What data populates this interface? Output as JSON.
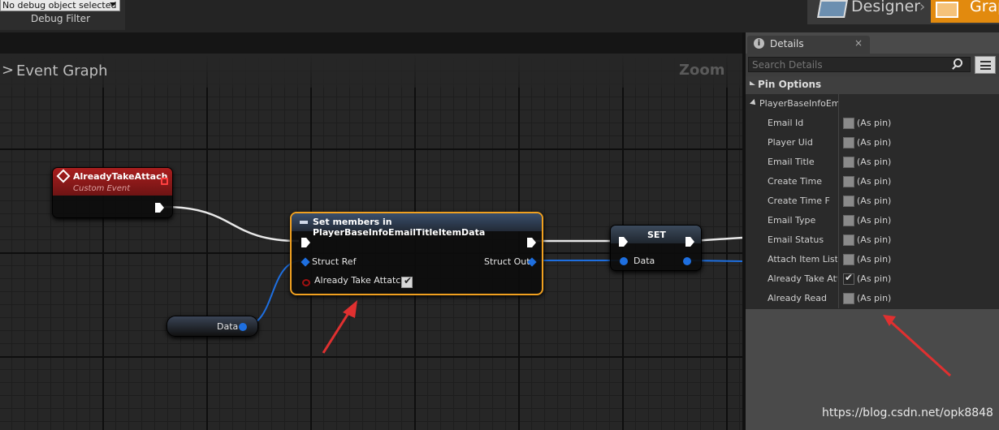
{
  "toolbar": {
    "debug_select_value": "No debug object selected",
    "debug_filter_label": "Debug Filter",
    "designer_label": "Designer",
    "graph_label": "Graph",
    "mode_separator": "›"
  },
  "graph": {
    "title": "Event Graph",
    "breadcrumb_glyph": ">",
    "zoom_label": "Zoom",
    "nodes": {
      "event": {
        "title": "AlreadyTakeAttach",
        "subtitle": "Custom Event"
      },
      "set_members": {
        "title": "Set members in PlayerBaseInfoEmailTitleItemData",
        "struct_ref_label": "Struct Ref",
        "struct_out_label": "Struct Out",
        "bool_pin_label": "Already Take Attatch",
        "bool_pin_checked": true
      },
      "set": {
        "title": "SET",
        "data_label": "Data"
      },
      "data_getter": {
        "label": "Data"
      }
    }
  },
  "details": {
    "tab_label": "Details",
    "close_glyph": "×",
    "search_placeholder": "Search Details",
    "section_label": "Pin Options",
    "struct_label": "PlayerBaseInfoEma",
    "rows": [
      {
        "name": "Email Id",
        "value": "(As pin)",
        "checked": false
      },
      {
        "name": "Player Uid",
        "value": "(As pin)",
        "checked": false
      },
      {
        "name": "Email Title",
        "value": "(As pin)",
        "checked": false
      },
      {
        "name": "Create Time",
        "value": "(As pin)",
        "checked": false
      },
      {
        "name": "Create Time F",
        "value": "(As pin)",
        "checked": false
      },
      {
        "name": "Email Type",
        "value": "(As pin)",
        "checked": false
      },
      {
        "name": "Email Status",
        "value": "(As pin)",
        "checked": false
      },
      {
        "name": "Attach Item List",
        "value": "(As pin)",
        "checked": false
      },
      {
        "name": "Already Take Atta",
        "value": "(As pin)",
        "checked": true
      },
      {
        "name": "Already Read",
        "value": "(As pin)",
        "checked": false
      }
    ]
  },
  "colors": {
    "selection_orange": "#f0a020",
    "event_red": "#a91e1e",
    "struct_pin_blue": "#1e6fe0",
    "annotation_red": "#e03030"
  },
  "watermark": "https://blog.csdn.net/opk8848"
}
